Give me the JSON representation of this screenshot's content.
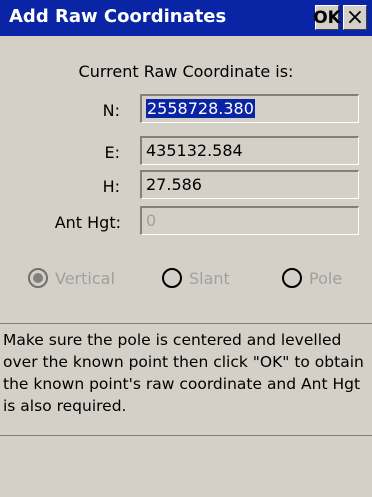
{
  "window": {
    "title": "Add Raw Coordinates",
    "ok_label": "OK",
    "close_label": "×"
  },
  "header": "Current Raw Coordinate is:",
  "fields": {
    "n": {
      "label": "N:",
      "value": "2558728.380"
    },
    "e": {
      "label": "E:",
      "value": "435132.584"
    },
    "h": {
      "label": "H:",
      "value": "27.586"
    },
    "ant_hgt": {
      "label": "Ant Hgt:",
      "value": "0"
    }
  },
  "radio": {
    "vertical": "Vertical",
    "slant": "Slant",
    "pole": "Pole",
    "selected": "Vertical"
  },
  "info_text": "Make sure the pole is centered and levelled over the known point then click \"OK\" to obtain the known point's raw coordinate and Ant Hgt is also required.",
  "colors": {
    "titlebar": "#0a24a6",
    "background": "#d4d0c8",
    "disabled_text": "#a0a0a0"
  }
}
